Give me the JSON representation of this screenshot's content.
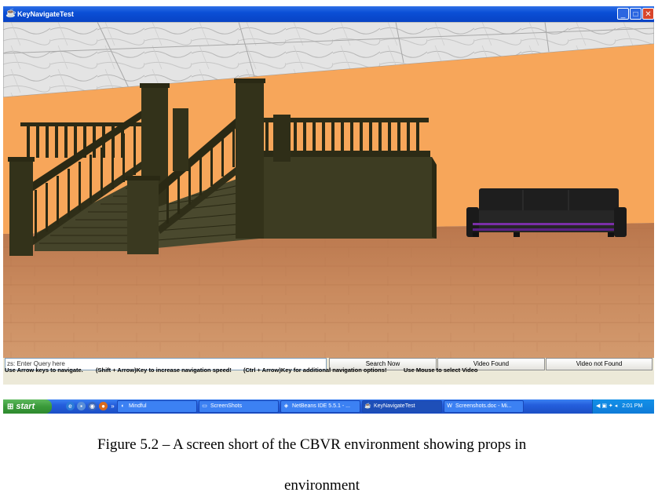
{
  "window": {
    "title": "KeyNavigateTest",
    "icon": "java-cup-icon"
  },
  "window_controls": {
    "minimize": "_",
    "maximize": "□",
    "close": "✕"
  },
  "controls": {
    "query_placeholder": "zs: Enter Query here",
    "search_button": "Search Now",
    "video_found_button": "Video Found",
    "video_not_found_button": "Video not Found"
  },
  "help": [
    "Use Arrow keys to navigate.",
    "(Shift + Arrow)Key to increase navigation speed!",
    "(Ctrl + Arrow)Key for additional navigation options!",
    "Use Mouse to select Video"
  ],
  "taskbar": {
    "start_label": "start",
    "tasks": [
      {
        "label": "Mindful",
        "icon": "browser-icon"
      },
      {
        "label": "ScreenShots",
        "icon": "folder-icon"
      },
      {
        "label": "NetBeans IDE 5.5.1 - ...",
        "icon": "netbeans-icon"
      },
      {
        "label": "KeyNavigateTest",
        "icon": "java-cup-icon"
      },
      {
        "label": "Screenshots.doc - Mi...",
        "icon": "word-icon"
      }
    ],
    "clock": "2:01 PM"
  },
  "caption": {
    "line1": "Figure 5.2 – A screen short of the CBVR environment showing props in",
    "line2": "environment"
  },
  "colors": {
    "wall": "#F7A65A",
    "ceiling": "#E7E7E7",
    "floor": "#C8845A",
    "stairs": "#3A3A1E",
    "sofa": "#1E1E1E",
    "sofa_trim": "#7B2FA8"
  }
}
